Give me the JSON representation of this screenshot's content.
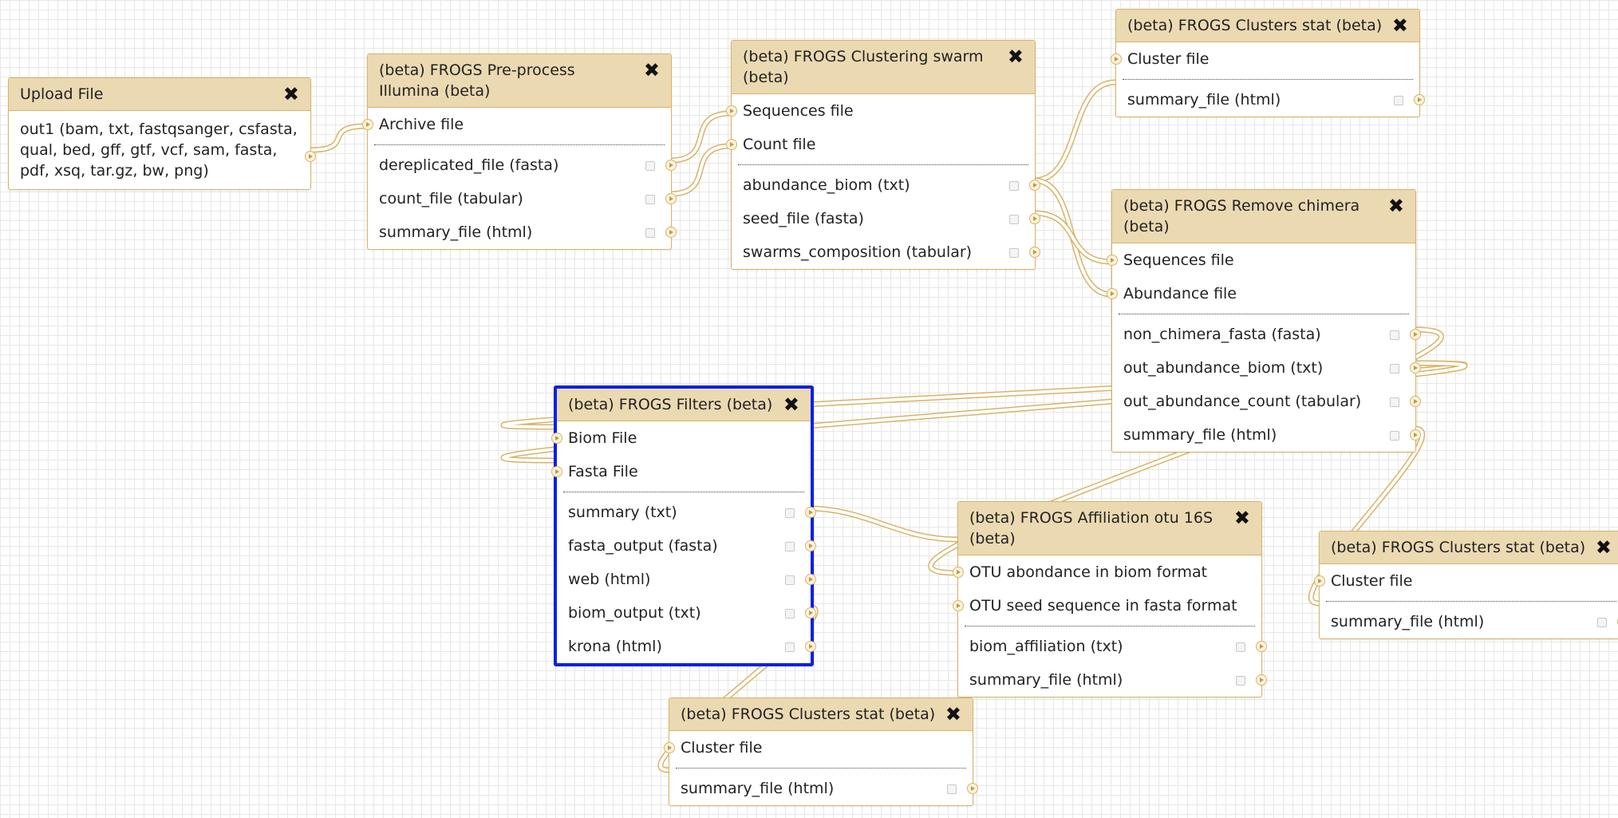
{
  "nodes": {
    "upload": {
      "title": "Upload File",
      "output_text": "out1 (bam, txt, fastqsanger, csfasta, qual, bed, gff, gtf, vcf, sam, fasta, pdf, xsq, tar.gz, bw, png)"
    },
    "preprocess": {
      "title": "(beta) FROGS Pre-process Illumina (beta)",
      "inputs": [
        "Archive file"
      ],
      "outputs": [
        "dereplicated_file (fasta)",
        "count_file (tabular)",
        "summary_file (html)"
      ]
    },
    "swarm": {
      "title": "(beta) FROGS Clustering swarm (beta)",
      "inputs": [
        "Sequences file",
        "Count file"
      ],
      "outputs": [
        "abundance_biom (txt)",
        "seed_file (fasta)",
        "swarms_composition (tabular)"
      ]
    },
    "stat1": {
      "title": "(beta) FROGS Clusters stat (beta)",
      "inputs": [
        "Cluster file"
      ],
      "outputs": [
        "summary_file (html)"
      ]
    },
    "chimera": {
      "title": "(beta) FROGS Remove chimera (beta)",
      "inputs": [
        "Sequences file",
        "Abundance file"
      ],
      "outputs": [
        "non_chimera_fasta (fasta)",
        "out_abundance_biom (txt)",
        "out_abundance_count (tabular)",
        "summary_file (html)"
      ]
    },
    "filters": {
      "title": "(beta) FROGS Filters (beta)",
      "inputs": [
        "Biom File",
        "Fasta File"
      ],
      "outputs": [
        "summary (txt)",
        "fasta_output (fasta)",
        "web (html)",
        "biom_output (txt)",
        "krona (html)"
      ]
    },
    "affiliation": {
      "title": "(beta) FROGS Affiliation otu 16S (beta)",
      "inputs": [
        "OTU abondance in biom format",
        "OTU seed sequence in fasta format"
      ],
      "outputs": [
        "biom_affiliation (txt)",
        "summary_file (html)"
      ]
    },
    "stat2": {
      "title": "(beta) FROGS Clusters stat (beta)",
      "inputs": [
        "Cluster file"
      ],
      "outputs": [
        "summary_file (html)"
      ]
    },
    "stat3": {
      "title": "(beta) FROGS Clusters stat (beta)",
      "inputs": [
        "Cluster file"
      ],
      "outputs": [
        "summary_file (html)"
      ]
    }
  },
  "close_glyph": "✖",
  "colors": {
    "node_border": "#d8b365",
    "header_bg": "#ebd9b2",
    "wire": "#d8b365",
    "selected_border": "#0a21e6",
    "grid": "#e7e7e7"
  }
}
